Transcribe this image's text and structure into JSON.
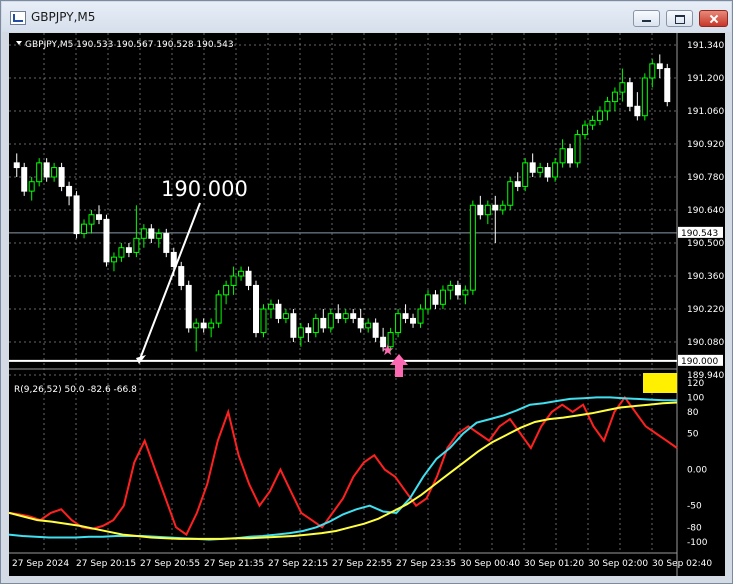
{
  "window": {
    "title": "GBPJPY,M5",
    "min_label": "minimize",
    "max_label": "maximize",
    "close_label": "close"
  },
  "chart_header": "GBPJPY,M5 190.533 190.567 190.528 190.543",
  "annotation_label": "190.000",
  "price_axis": [
    "191.340",
    "191.200",
    "191.060",
    "190.920",
    "190.780",
    "190.640",
    "190.500",
    "190.360",
    "190.220",
    "190.080",
    "189.940"
  ],
  "current_price_tag": "190.543",
  "line_price_tag": "190.000",
  "time_axis": [
    "27 Sep 2024",
    "27 Sep 20:15",
    "27 Sep 20:55",
    "27 Sep 21:35",
    "27 Sep 22:15",
    "27 Sep 22:55",
    "27 Sep 23:35",
    "30 Sep 00:40",
    "30 Sep 01:20",
    "30 Sep 02:00",
    "30 Sep 02:40"
  ],
  "indicator": {
    "header": "R(9,26,52) 50.0 -82.6 -66.8",
    "axis": [
      "120",
      "100",
      "80",
      "50",
      "0.00",
      "-50",
      "-80",
      "-100"
    ]
  },
  "colors": {
    "bull": "#00ff00",
    "bear": "#ffffff",
    "red": "#ff2020",
    "cyan": "#40e0f0",
    "yellow": "#ffff40",
    "marker": "#ff69b4"
  },
  "chart_data": {
    "type": "candlestick",
    "symbol": "GBPJPY",
    "timeframe": "M5",
    "ylim": [
      189.94,
      191.34
    ],
    "horizontal_line": 190.0,
    "current_price": 190.543,
    "candles": [
      [
        190.84,
        190.88,
        190.78,
        190.82
      ],
      [
        190.82,
        190.84,
        190.7,
        190.72
      ],
      [
        190.72,
        190.78,
        190.68,
        190.76
      ],
      [
        190.76,
        190.86,
        190.74,
        190.84
      ],
      [
        190.84,
        190.86,
        190.76,
        190.78
      ],
      [
        190.78,
        190.84,
        190.76,
        190.82
      ],
      [
        190.82,
        190.84,
        190.72,
        190.74
      ],
      [
        190.74,
        190.76,
        190.66,
        190.7
      ],
      [
        190.7,
        190.72,
        190.52,
        190.54
      ],
      [
        190.54,
        190.6,
        190.52,
        190.58
      ],
      [
        190.58,
        190.64,
        190.54,
        190.62
      ],
      [
        190.62,
        190.66,
        190.58,
        190.6
      ],
      [
        190.6,
        190.62,
        190.4,
        190.42
      ],
      [
        190.42,
        190.46,
        190.38,
        190.44
      ],
      [
        190.44,
        190.5,
        190.42,
        190.48
      ],
      [
        190.48,
        190.5,
        190.44,
        190.46
      ],
      [
        190.46,
        190.66,
        190.44,
        190.52
      ],
      [
        190.52,
        190.58,
        190.48,
        190.56
      ],
      [
        190.56,
        190.58,
        190.5,
        190.52
      ],
      [
        190.52,
        190.56,
        190.48,
        190.54
      ],
      [
        190.54,
        190.56,
        190.44,
        190.46
      ],
      [
        190.46,
        190.48,
        190.36,
        190.4
      ],
      [
        190.4,
        190.42,
        190.3,
        190.32
      ],
      [
        190.32,
        190.34,
        190.12,
        190.14
      ],
      [
        190.14,
        190.18,
        190.04,
        190.16
      ],
      [
        190.16,
        190.18,
        190.12,
        190.14
      ],
      [
        190.14,
        190.18,
        190.1,
        190.16
      ],
      [
        190.16,
        190.3,
        190.14,
        190.28
      ],
      [
        190.28,
        190.34,
        190.24,
        190.32
      ],
      [
        190.32,
        190.4,
        190.28,
        190.36
      ],
      [
        190.36,
        190.4,
        190.34,
        190.38
      ],
      [
        190.38,
        190.4,
        190.3,
        190.32
      ],
      [
        190.32,
        190.34,
        190.1,
        190.12
      ],
      [
        190.12,
        190.24,
        190.1,
        190.22
      ],
      [
        190.22,
        190.26,
        190.18,
        190.24
      ],
      [
        190.24,
        190.26,
        190.16,
        190.18
      ],
      [
        190.18,
        190.22,
        190.16,
        190.2
      ],
      [
        190.2,
        190.22,
        190.08,
        190.1
      ],
      [
        190.1,
        190.16,
        190.06,
        190.14
      ],
      [
        190.14,
        190.16,
        190.08,
        190.12
      ],
      [
        190.12,
        190.2,
        190.1,
        190.18
      ],
      [
        190.18,
        190.22,
        190.12,
        190.14
      ],
      [
        190.14,
        190.22,
        190.12,
        190.2
      ],
      [
        190.2,
        190.24,
        190.16,
        190.18
      ],
      [
        190.18,
        190.22,
        190.16,
        190.2
      ],
      [
        190.2,
        190.22,
        190.16,
        190.18
      ],
      [
        190.18,
        190.22,
        190.12,
        190.14
      ],
      [
        190.14,
        190.18,
        190.12,
        190.16
      ],
      [
        190.16,
        190.18,
        190.08,
        190.1
      ],
      [
        190.1,
        190.14,
        190.04,
        190.06
      ],
      [
        190.06,
        190.14,
        190.04,
        190.12
      ],
      [
        190.12,
        190.22,
        190.1,
        190.2
      ],
      [
        190.2,
        190.24,
        190.16,
        190.18
      ],
      [
        190.18,
        190.2,
        190.14,
        190.16
      ],
      [
        190.16,
        190.24,
        190.14,
        190.22
      ],
      [
        190.22,
        190.3,
        190.2,
        190.28
      ],
      [
        190.28,
        190.3,
        190.22,
        190.24
      ],
      [
        190.24,
        190.32,
        190.22,
        190.3
      ],
      [
        190.3,
        190.34,
        190.26,
        190.32
      ],
      [
        190.32,
        190.34,
        190.26,
        190.28
      ],
      [
        190.28,
        190.32,
        190.24,
        190.3
      ],
      [
        190.3,
        190.68,
        190.28,
        190.66
      ],
      [
        190.66,
        190.7,
        190.6,
        190.62
      ],
      [
        190.62,
        190.68,
        190.58,
        190.66
      ],
      [
        190.66,
        190.7,
        190.5,
        190.64
      ],
      [
        190.64,
        190.68,
        190.62,
        190.66
      ],
      [
        190.66,
        190.78,
        190.64,
        190.76
      ],
      [
        190.76,
        190.8,
        190.72,
        190.74
      ],
      [
        190.74,
        190.86,
        190.72,
        190.84
      ],
      [
        190.84,
        190.88,
        190.78,
        190.8
      ],
      [
        190.8,
        190.84,
        190.78,
        190.82
      ],
      [
        190.82,
        190.84,
        190.76,
        190.78
      ],
      [
        190.78,
        190.86,
        190.76,
        190.84
      ],
      [
        190.84,
        190.94,
        190.82,
        190.9
      ],
      [
        190.9,
        190.92,
        190.82,
        190.84
      ],
      [
        190.84,
        190.98,
        190.82,
        190.96
      ],
      [
        190.96,
        191.02,
        190.94,
        191.0
      ],
      [
        191.0,
        191.04,
        190.98,
        191.02
      ],
      [
        191.02,
        191.08,
        191.0,
        191.06
      ],
      [
        191.06,
        191.12,
        191.02,
        191.1
      ],
      [
        191.1,
        191.16,
        191.06,
        191.14
      ],
      [
        191.14,
        191.24,
        191.1,
        191.18
      ],
      [
        191.18,
        191.2,
        191.06,
        191.08
      ],
      [
        191.08,
        191.14,
        191.02,
        191.04
      ],
      [
        191.04,
        191.22,
        191.02,
        191.2
      ],
      [
        191.2,
        191.28,
        191.16,
        191.26
      ],
      [
        191.26,
        191.3,
        191.2,
        191.24
      ],
      [
        191.24,
        191.26,
        191.08,
        191.1
      ]
    ],
    "indicator_lines": {
      "red": [
        -60,
        -62,
        -65,
        -70,
        -60,
        -55,
        -70,
        -80,
        -82,
        -78,
        -70,
        -50,
        10,
        40,
        0,
        -40,
        -80,
        -90,
        -60,
        -20,
        40,
        80,
        20,
        -20,
        -50,
        -30,
        0,
        -30,
        -60,
        -70,
        -80,
        -60,
        -40,
        -10,
        10,
        20,
        0,
        -10,
        -30,
        -50,
        -40,
        -10,
        30,
        50,
        60,
        50,
        40,
        60,
        70,
        50,
        30,
        60,
        80,
        90,
        80,
        90,
        60,
        40,
        80,
        100,
        80,
        60,
        50,
        40,
        30
      ],
      "cyan": [
        -90,
        -92,
        -93,
        -94,
        -94,
        -94,
        -93,
        -93,
        -92,
        -92,
        -92,
        -93,
        -94,
        -95,
        -96,
        -97,
        -96,
        -95,
        -93,
        -92,
        -90,
        -88,
        -85,
        -80,
        -72,
        -62,
        -55,
        -50,
        -58,
        -60,
        -40,
        -10,
        15,
        30,
        50,
        65,
        70,
        75,
        82,
        90,
        92,
        95,
        98,
        99,
        100,
        100,
        99,
        98,
        97,
        96,
        96
      ],
      "yellow": [
        -60,
        -65,
        -70,
        -72,
        -75,
        -78,
        -82,
        -86,
        -90,
        -92,
        -94,
        -95,
        -96,
        -96,
        -96,
        -96,
        -95,
        -95,
        -94,
        -93,
        -92,
        -90,
        -88,
        -85,
        -80,
        -75,
        -68,
        -58,
        -48,
        -35,
        -20,
        -5,
        10,
        25,
        38,
        48,
        58,
        66,
        70,
        72,
        75,
        78,
        82,
        86,
        88,
        90,
        92,
        93
      ]
    },
    "indicator_ylim": [
      -110,
      120
    ]
  }
}
